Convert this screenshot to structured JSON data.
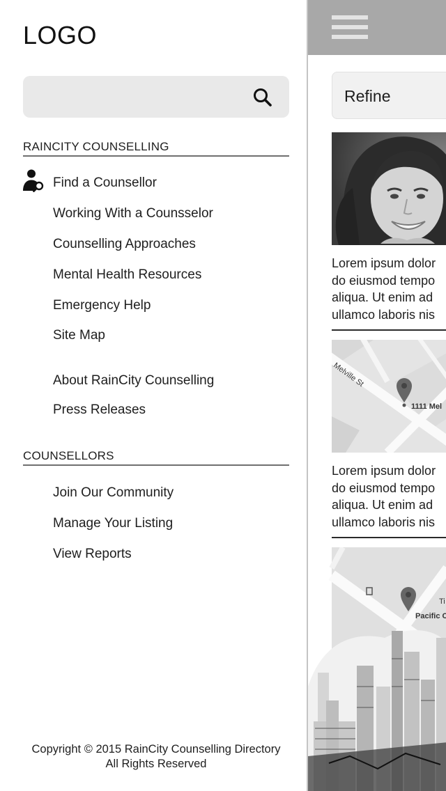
{
  "drawer": {
    "logo": "LOGO",
    "search": {
      "placeholder": "",
      "value": ""
    },
    "sections": [
      {
        "title": "RAINCITY COUNSELLING",
        "items": [
          {
            "label": "Find a Counsellor",
            "icon": "user-search-icon"
          },
          {
            "label": "Working With a Counsselor"
          },
          {
            "label": "Counselling Approaches"
          },
          {
            "label": "Mental Health Resources"
          },
          {
            "label": "Emergency Help"
          },
          {
            "label": "Site Map"
          },
          {
            "label": "About RainCity Counselling"
          },
          {
            "label": "Press Releases"
          }
        ]
      },
      {
        "title": "COUNSELLORS",
        "items": [
          {
            "label": "Join Our Community"
          },
          {
            "label": "Manage Your Listing"
          },
          {
            "label": "View Reports"
          }
        ]
      }
    ],
    "footer": {
      "copyright": "Copyright © 2015 RainCity Counselling Directory",
      "rights": "All Rights Reserved"
    }
  },
  "main": {
    "refine_label": "Refine",
    "cards": [
      {
        "media": "counsellor-photo",
        "text": [
          "Lorem ipsum dolor",
          "do eiusmod tempo",
          "aliqua. Ut enim ad",
          "ullamco laboris nis"
        ]
      },
      {
        "media": "map",
        "map_street": "Melville St",
        "map_address": "1111 Mel",
        "text": [
          "Lorem ipsum dolor",
          "do eiusmod tempo",
          "aliqua. Ut enim ad",
          "ullamco laboris nis"
        ]
      },
      {
        "media": "map",
        "map_place_a": "Ti",
        "map_place_b": "Pacific C"
      }
    ]
  },
  "colors": {
    "topbar": "#a8a8a8",
    "search_bg": "#e9e9e9",
    "divider": "#6f6f6f",
    "text": "#1e1e1e"
  }
}
